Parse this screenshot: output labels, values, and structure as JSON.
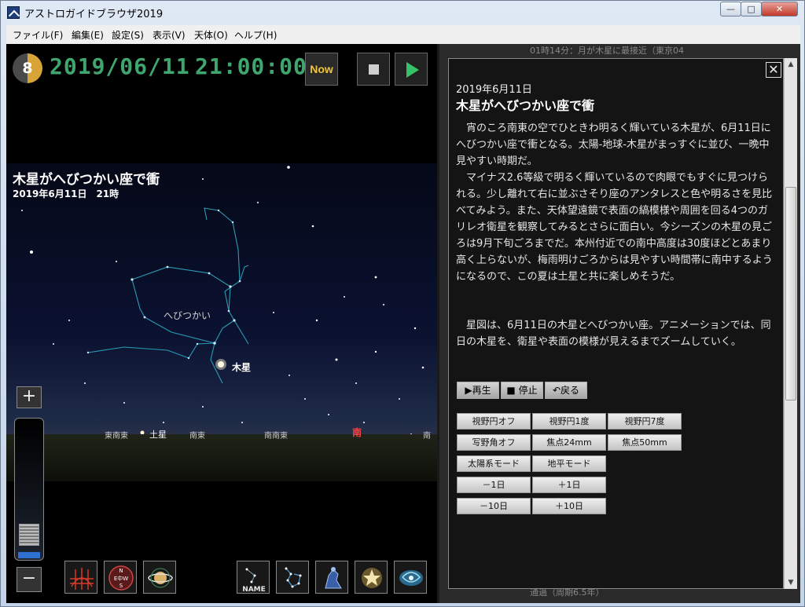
{
  "window": {
    "title": "アストロガイドブラウザ2019"
  },
  "caption": {
    "minimize": "—",
    "maximize": "□",
    "close": "✕"
  },
  "menu": [
    "ファイル(F)",
    "編集(E)",
    "設定(S)",
    "表示(V)",
    "天体(O)",
    "ヘルプ(H)"
  ],
  "status": {
    "moon_age": "8",
    "date": "2019/06/11",
    "time": "21:00:00",
    "now_label": "Now"
  },
  "sky": {
    "title": "木星がへびつかい座で衝",
    "subtitle": "2019年6月11日　21時",
    "constellation_label": "へびつかい",
    "jupiter_label": "木星",
    "saturn_label": "土星",
    "directions": [
      "東南東",
      "南東",
      "南南東",
      "南",
      "南"
    ]
  },
  "toolbar_icons": [
    "grid-icon",
    "compass-icon",
    "planet-icon",
    "name-icon",
    "constellation-line-icon",
    "constellation-art-icon",
    "star-icon",
    "galaxy-icon"
  ],
  "tool_labels": {
    "compass": "N\nE中W\nS",
    "name": "NAME"
  },
  "zoom": {
    "plus": "+",
    "minus": "−"
  },
  "background_text": {
    "top": "01時14分：月が木星に最接近（東京04",
    "bottom": "通過（周期6.5年）"
  },
  "article": {
    "close": "✕",
    "date": "2019年6月11日",
    "title": "木星がへびつかい座で衝",
    "paragraphs": [
      "宵のころ南東の空でひときわ明るく輝いている木星が、6月11日にへびつかい座で衝となる。太陽-地球-木星がまっすぐに並び、一晩中見やすい時期だ。",
      "マイナス2.6等級で明るく輝いているので肉眼でもすぐに見つけられる。少し離れて右に並ぶさそり座のアンタレスと色や明るさを見比べてみよう。また、天体望遠鏡で表面の縞模様や周囲を回る4つのガリレオ衛星を観察してみるとさらに面白い。今シーズンの木星の見ごろは9月下旬ごろまでだ。本州付近での南中高度は30度ほどとあまり高く上らないが、梅雨明けごろからは見やすい時間帯に南中するようになるので、この夏は土星と共に楽しめそうだ。",
      "星図は、6月11日の木星とへびつかい座。アニメーションでは、同日の木星を、衛星や表面の模様が見えるまでズームしていく。"
    ],
    "controls": {
      "play": "▶再生",
      "stop": "■ 停止",
      "back": "↶戻る"
    },
    "options": [
      [
        "視野円オフ",
        "視野円1度",
        "視野円7度"
      ],
      [
        "写野角オフ",
        "焦点24mm",
        "焦点50mm"
      ],
      [
        "太陽系モード",
        "地平モード"
      ],
      [
        "－1日",
        "＋1日"
      ],
      [
        "－10日",
        "＋10日"
      ]
    ]
  },
  "scrollbar": {
    "up": "▲",
    "down": "▼"
  }
}
